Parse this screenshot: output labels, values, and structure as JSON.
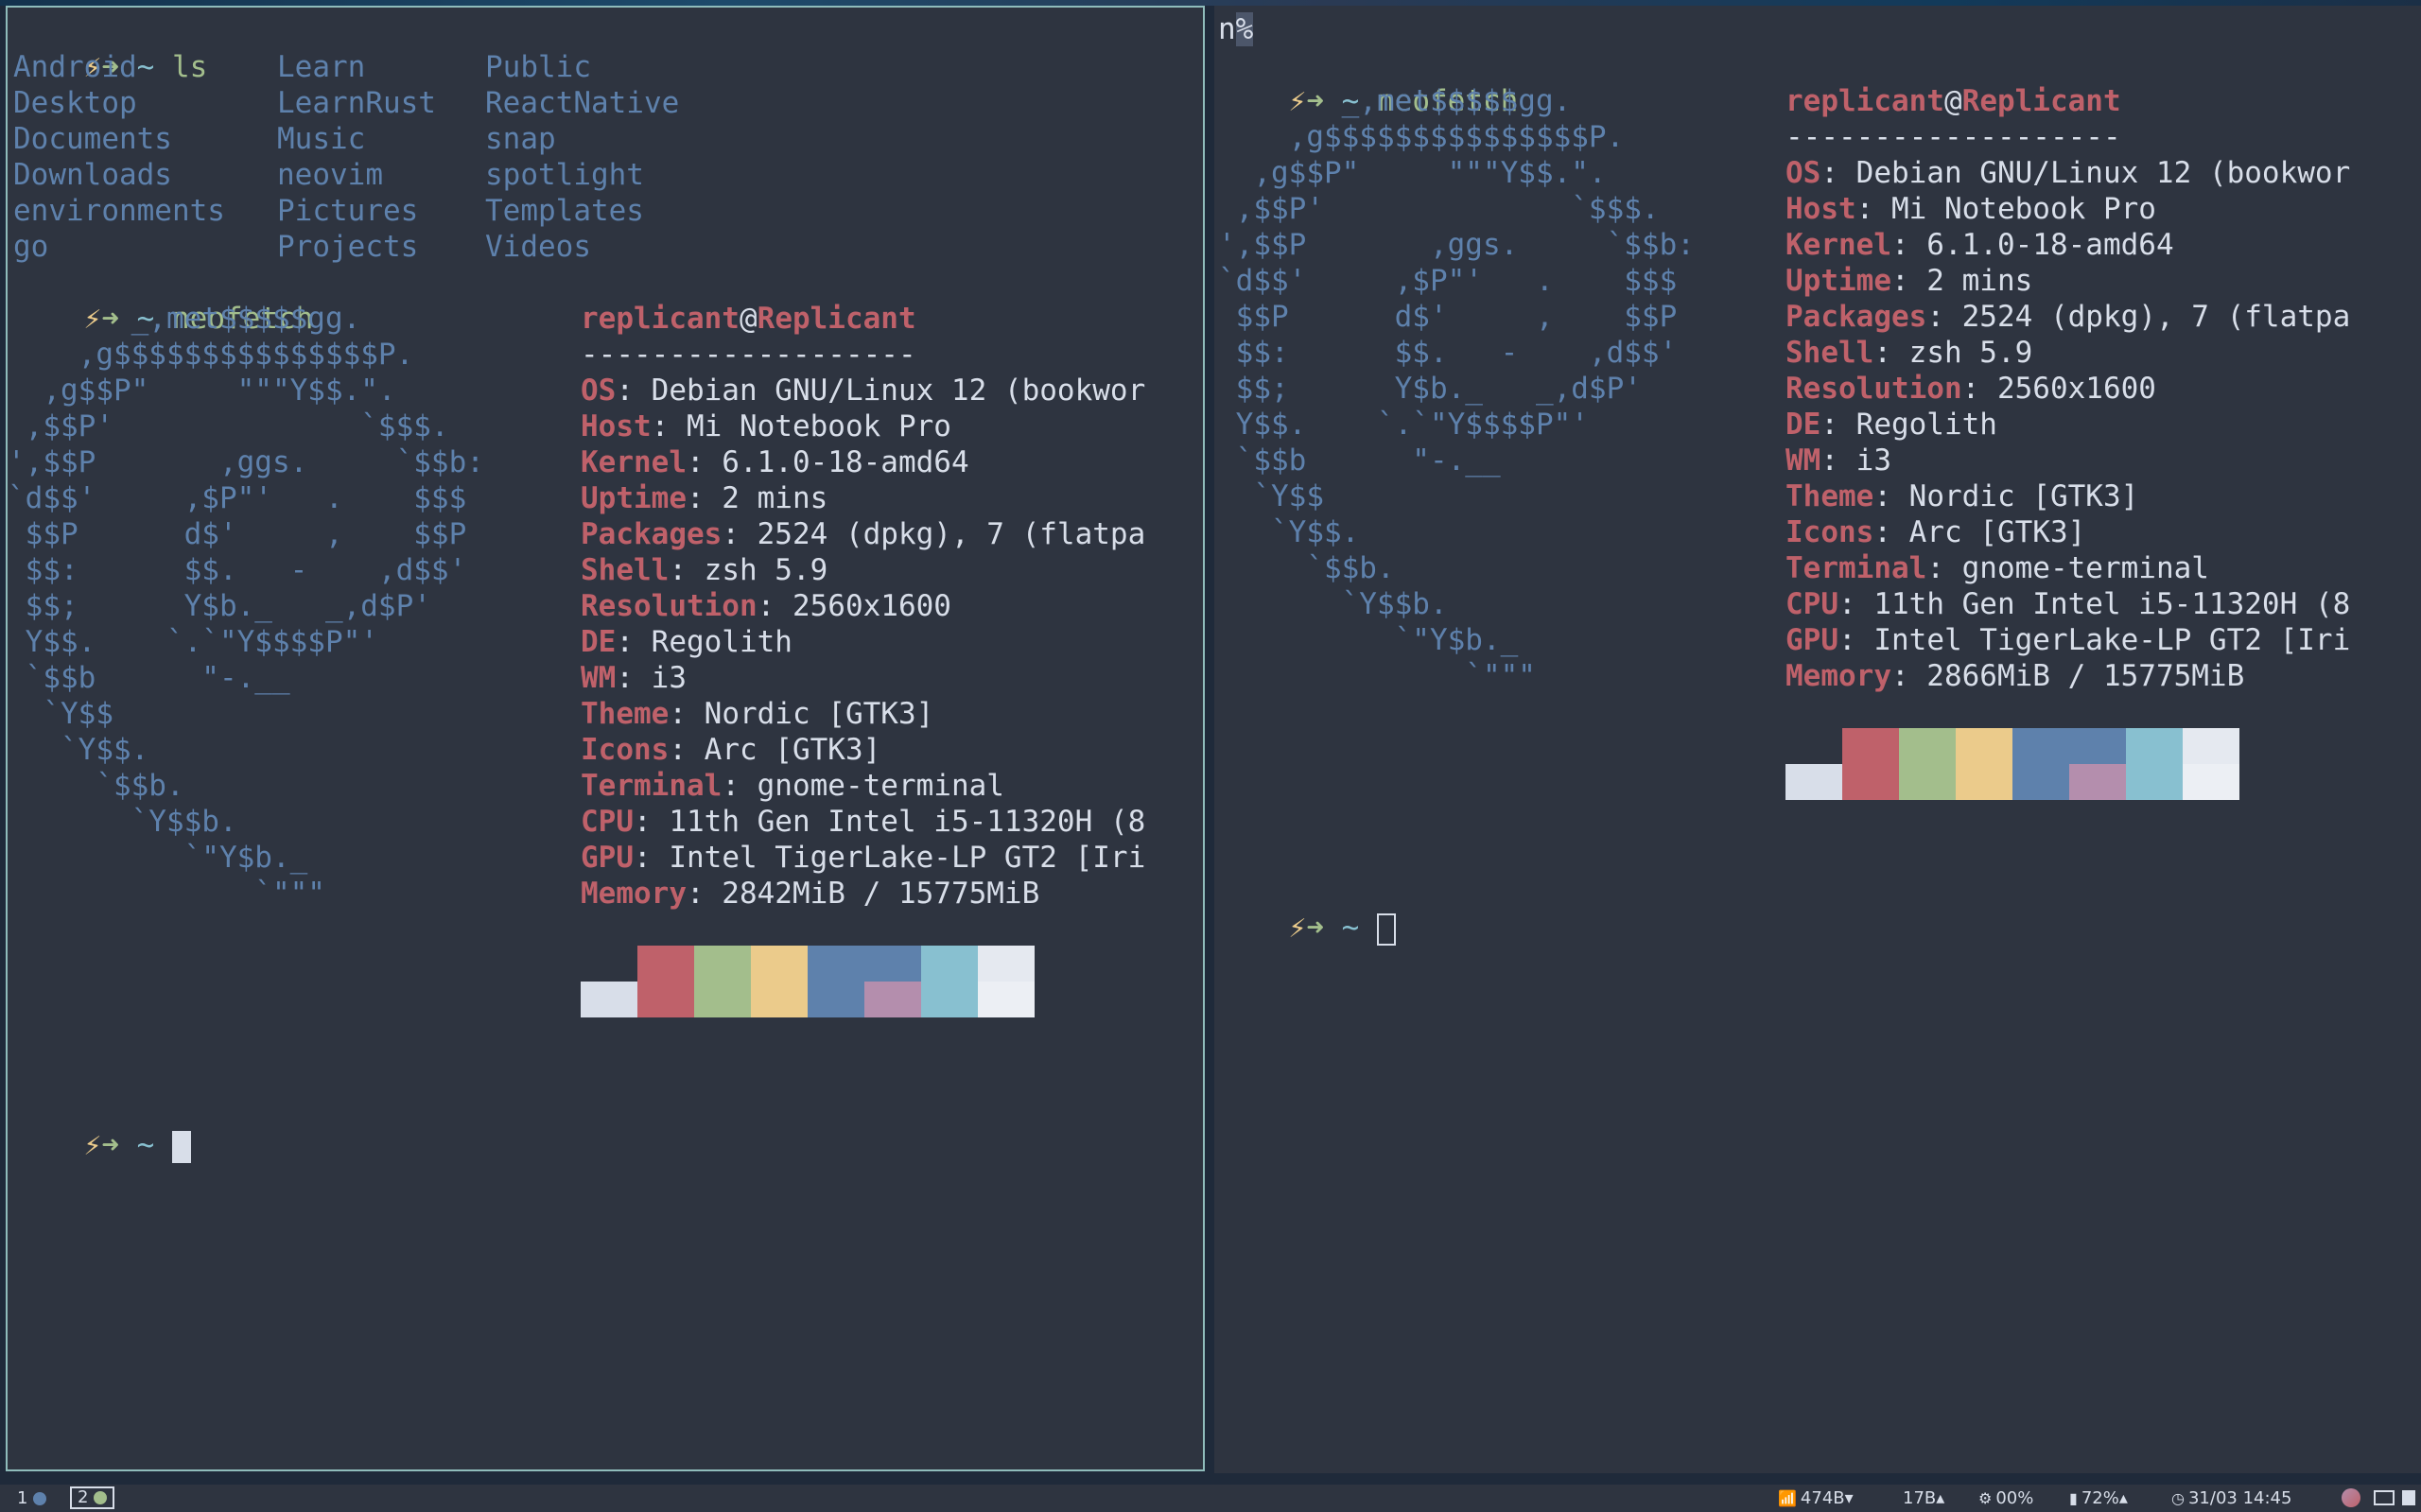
{
  "prompt": {
    "bolt": "⚡",
    "arrow": "➜",
    "tilde": "~"
  },
  "left": {
    "cmd1": "ls",
    "ls_columns": [
      [
        "Android",
        "Desktop",
        "Documents",
        "Downloads",
        "environments",
        "go"
      ],
      [
        "Learn",
        "LearnRust",
        "Music",
        "neovim",
        "Pictures",
        "Projects"
      ],
      [
        "Public",
        "ReactNative",
        "snap",
        "spotlight",
        "Templates",
        "Videos"
      ]
    ],
    "cmd2": "neofetch",
    "logo": [
      "       _,met$$$$$gg.",
      "    ,g$$$$$$$$$$$$$$$P.",
      "  ,g$$P\"     \"\"\"Y$$.\".",
      " ,$$P'              `$$$.",
      "',$$P       ,ggs.     `$$b:",
      "`d$$'     ,$P\"'   .    $$$",
      " $$P      d$'     ,    $$P",
      " $$:      $$.   -    ,d$$'",
      " $$;      Y$b._   _,d$P'",
      " Y$$.    `.`\"Y$$$$P\"'",
      " `$$b      \"-.__",
      "  `Y$$",
      "   `Y$$.",
      "     `$$b.",
      "       `Y$$b.",
      "          `\"Y$b._",
      "              `\"\"\""
    ],
    "info_user": "replicant",
    "info_at": "@",
    "info_host": "Replicant",
    "info_sep": "-------------------",
    "info": [
      {
        "k": "OS",
        "v": ": Debian GNU/Linux 12 (bookwor"
      },
      {
        "k": "Host",
        "v": ": Mi Notebook Pro"
      },
      {
        "k": "Kernel",
        "v": ": 6.1.0-18-amd64"
      },
      {
        "k": "Uptime",
        "v": ": 2 mins"
      },
      {
        "k": "Packages",
        "v": ": 2524 (dpkg), 7 (flatpa"
      },
      {
        "k": "Shell",
        "v": ": zsh 5.9"
      },
      {
        "k": "Resolution",
        "v": ": 2560x1600"
      },
      {
        "k": "DE",
        "v": ": Regolith"
      },
      {
        "k": "WM",
        "v": ": i3"
      },
      {
        "k": "Theme",
        "v": ": Nordic [GTK3]"
      },
      {
        "k": "Icons",
        "v": ": Arc [GTK3]"
      },
      {
        "k": "Terminal",
        "v": ": gnome-terminal"
      },
      {
        "k": "CPU",
        "v": ": 11th Gen Intel i5-11320H (8"
      },
      {
        "k": "GPU",
        "v": ": Intel TigerLake-LP GT2 [Iri"
      },
      {
        "k": "Memory",
        "v": ": 2842MiB / 15775MiB"
      }
    ]
  },
  "right": {
    "top_char": "n",
    "top_pct": "%",
    "cmd": "neofetch",
    "info": [
      {
        "k": "OS",
        "v": ": Debian GNU/Linux 12 (bookwor"
      },
      {
        "k": "Host",
        "v": ": Mi Notebook Pro"
      },
      {
        "k": "Kernel",
        "v": ": 6.1.0-18-amd64"
      },
      {
        "k": "Uptime",
        "v": ": 2 mins"
      },
      {
        "k": "Packages",
        "v": ": 2524 (dpkg), 7 (flatpa"
      },
      {
        "k": "Shell",
        "v": ": zsh 5.9"
      },
      {
        "k": "Resolution",
        "v": ": 2560x1600"
      },
      {
        "k": "DE",
        "v": ": Regolith"
      },
      {
        "k": "WM",
        "v": ": i3"
      },
      {
        "k": "Theme",
        "v": ": Nordic [GTK3]"
      },
      {
        "k": "Icons",
        "v": ": Arc [GTK3]"
      },
      {
        "k": "Terminal",
        "v": ": gnome-terminal"
      },
      {
        "k": "CPU",
        "v": ": 11th Gen Intel i5-11320H (8"
      },
      {
        "k": "GPU",
        "v": ": Intel TigerLake-LP GT2 [Iri"
      },
      {
        "k": "Memory",
        "v": ": 2866MiB / 15775MiB"
      }
    ]
  },
  "palette_top": [
    "#2e3440",
    "#bf616a",
    "#a3be8c",
    "#ebcb8b",
    "#5e81ac",
    "#5e81ac",
    "#88c0d0",
    "#e5e9f0"
  ],
  "palette_bottom": [
    "#d8dee9",
    "#bf616a",
    "#a3be8c",
    "#ebcb8b",
    "#5e81ac",
    "#b48ead",
    "#88c0d0",
    "#eceff4"
  ],
  "statusbar": {
    "ws1": "1",
    "ws2": "2",
    "ws1_dot": "#5e81ac",
    "ws2_dot": "#a3be8c",
    "net_down": "474B",
    "net_up": "17B",
    "cpu": "00%",
    "battery": "72%",
    "datetime": "31/03 14:45",
    "icons": {
      "wifi": "wifi-icon",
      "cpu": "cpu-icon",
      "battery": "battery-icon",
      "clock": "clock-icon",
      "power": "power-icon"
    }
  }
}
